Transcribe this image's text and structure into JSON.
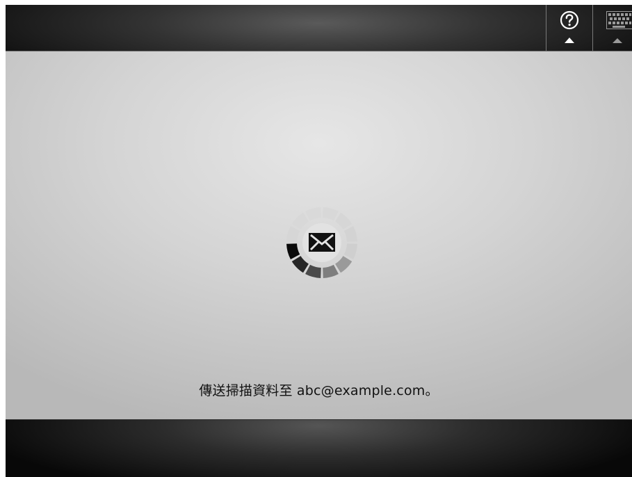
{
  "topbar": {
    "help_icon": "help-question-icon",
    "keyboard_icon": "keyboard-icon"
  },
  "main": {
    "status_icon": "envelope-icon",
    "spinner": "loading-spinner",
    "status_message": "傳送掃描資料至 abc@example.com。"
  }
}
